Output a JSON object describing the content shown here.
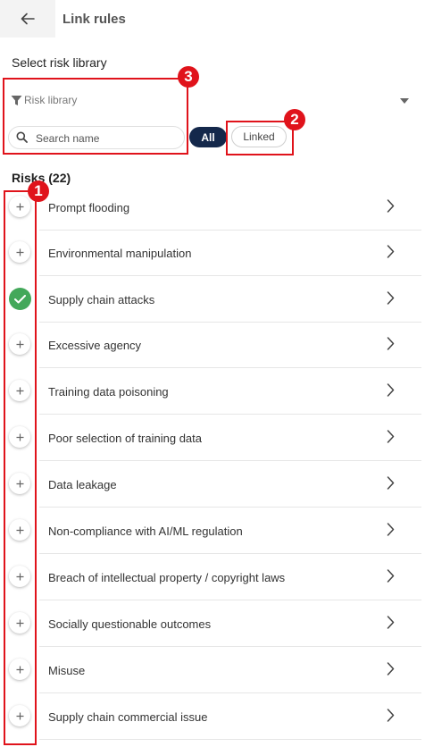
{
  "header": {
    "title": "Link rules"
  },
  "library": {
    "section_label": "Select risk library",
    "filter_placeholder": "Risk library"
  },
  "search": {
    "placeholder": "Search name"
  },
  "filters": {
    "all_label": "All",
    "linked_label": "Linked"
  },
  "risks": {
    "heading": "Risks (22)",
    "items": [
      {
        "label": "Prompt flooding",
        "linked": false
      },
      {
        "label": "Environmental manipulation",
        "linked": false
      },
      {
        "label": "Supply chain attacks",
        "linked": true
      },
      {
        "label": "Excessive agency",
        "linked": false
      },
      {
        "label": "Training data poisoning",
        "linked": false
      },
      {
        "label": "Poor selection of training data",
        "linked": false
      },
      {
        "label": "Data leakage",
        "linked": false
      },
      {
        "label": "Non-compliance with AI/ML regulation",
        "linked": false
      },
      {
        "label": "Breach of intellectual property / copyright laws",
        "linked": false
      },
      {
        "label": "Socially questionable outcomes",
        "linked": false
      },
      {
        "label": "Misuse",
        "linked": false
      },
      {
        "label": "Supply chain commercial issue",
        "linked": false
      }
    ]
  },
  "annotations": {
    "badge_1": "1",
    "badge_2": "2",
    "badge_3": "3"
  },
  "colors": {
    "accent_dark": "#14284b",
    "linked_green": "#43a85a",
    "annotation_red": "#e0131b"
  }
}
